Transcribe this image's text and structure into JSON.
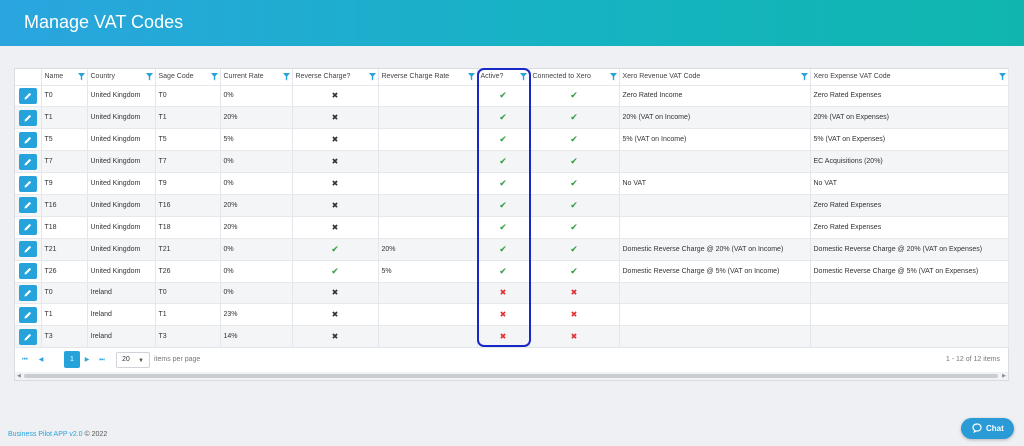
{
  "header": {
    "title": "Manage VAT Codes"
  },
  "colors": {
    "accent": "#27a3dc",
    "header_start": "#2aa5df",
    "header_end": "#10b6ae",
    "check": "#2e9a3e",
    "cross_red": "#e23030",
    "highlight": "#1728c8"
  },
  "table": {
    "columns": [
      "Name",
      "Country",
      "Sage Code",
      "Current Rate",
      "Reverse Charge?",
      "Reverse Charge Rate",
      "Active?",
      "Connected to Xero",
      "Xero Revenue VAT Code",
      "Xero Expense VAT Code"
    ],
    "rows": [
      {
        "name": "T0",
        "country": "United Kingdom",
        "sage": "T0",
        "rate": "0%",
        "reverse": false,
        "rc_rate": "",
        "active": true,
        "xero": true,
        "rev_code": "Zero Rated Income",
        "exp_code": "Zero Rated Expenses"
      },
      {
        "name": "T1",
        "country": "United Kingdom",
        "sage": "T1",
        "rate": "20%",
        "reverse": false,
        "rc_rate": "",
        "active": true,
        "xero": true,
        "rev_code": "20% (VAT on Income)",
        "exp_code": "20% (VAT on Expenses)"
      },
      {
        "name": "T5",
        "country": "United Kingdom",
        "sage": "T5",
        "rate": "5%",
        "reverse": false,
        "rc_rate": "",
        "active": true,
        "xero": true,
        "rev_code": "5% (VAT on Income)",
        "exp_code": "5% (VAT on Expenses)"
      },
      {
        "name": "T7",
        "country": "United Kingdom",
        "sage": "T7",
        "rate": "0%",
        "reverse": false,
        "rc_rate": "",
        "active": true,
        "xero": true,
        "rev_code": "",
        "exp_code": "EC Acquisitions (20%)"
      },
      {
        "name": "T9",
        "country": "United Kingdom",
        "sage": "T9",
        "rate": "0%",
        "reverse": false,
        "rc_rate": "",
        "active": true,
        "xero": true,
        "rev_code": "No VAT",
        "exp_code": "No VAT"
      },
      {
        "name": "T16",
        "country": "United Kingdom",
        "sage": "T16",
        "rate": "20%",
        "reverse": false,
        "rc_rate": "",
        "active": true,
        "xero": true,
        "rev_code": "",
        "exp_code": "Zero Rated Expenses"
      },
      {
        "name": "T18",
        "country": "United Kingdom",
        "sage": "T18",
        "rate": "20%",
        "reverse": false,
        "rc_rate": "",
        "active": true,
        "xero": true,
        "rev_code": "",
        "exp_code": "Zero Rated Expenses"
      },
      {
        "name": "T21",
        "country": "United Kingdom",
        "sage": "T21",
        "rate": "0%",
        "reverse": true,
        "rc_rate": "20%",
        "active": true,
        "xero": true,
        "rev_code": "Domestic Reverse Charge @ 20% (VAT on Income)",
        "exp_code": "Domestic Reverse Charge @ 20% (VAT on Expenses)"
      },
      {
        "name": "T26",
        "country": "United Kingdom",
        "sage": "T26",
        "rate": "0%",
        "reverse": true,
        "rc_rate": "5%",
        "active": true,
        "xero": true,
        "rev_code": "Domestic Reverse Charge @ 5% (VAT on Income)",
        "exp_code": "Domestic Reverse Charge @ 5% (VAT on Expenses)"
      },
      {
        "name": "T0",
        "country": "Ireland",
        "sage": "T0",
        "rate": "0%",
        "reverse": false,
        "rc_rate": "",
        "active": false,
        "xero": false,
        "rev_code": "",
        "exp_code": ""
      },
      {
        "name": "T1",
        "country": "Ireland",
        "sage": "T1",
        "rate": "23%",
        "reverse": false,
        "rc_rate": "",
        "active": false,
        "xero": false,
        "rev_code": "",
        "exp_code": ""
      },
      {
        "name": "T3",
        "country": "Ireland",
        "sage": "T3",
        "rate": "14%",
        "reverse": false,
        "rc_rate": "",
        "active": false,
        "xero": false,
        "rev_code": "",
        "exp_code": ""
      }
    ]
  },
  "pager": {
    "first": "⏮",
    "prev": "◀",
    "current_page": "1",
    "next": "▶",
    "last": "⏭",
    "page_size": "20",
    "page_size_caret": "▼",
    "items_per_page_label": "items per page",
    "count_label": "1 - 12 of 12 items"
  },
  "footer": {
    "brand": "Business Pilot APP v2.0",
    "copyright": " © 2022"
  },
  "chat": {
    "label": "Chat"
  },
  "glyphs": {
    "check": "✔",
    "cross": "✖"
  },
  "icons": {
    "edit": "pencil-icon",
    "filter": "filter-icon",
    "chat": "chat-bubble-icon"
  }
}
